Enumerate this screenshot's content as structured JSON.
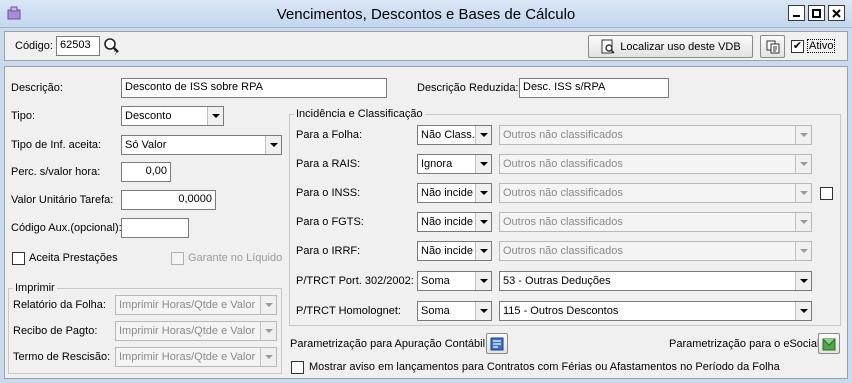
{
  "window": {
    "title": "Vencimentos, Descontos e Bases de Cálculo",
    "app_icon": "app-icon",
    "minimize_icon": "minimize-icon",
    "maximize_icon": "maximize-icon",
    "close_icon": "close-icon"
  },
  "toolbar": {
    "codigo_label": "Código:",
    "codigo_value": "62503",
    "search_icon": "search-icon",
    "localizar_label": "Localizar uso deste VDB",
    "copy_icon": "copy-icon",
    "ativo_label": "Ativo",
    "ativo_checked": true
  },
  "form": {
    "descricao_label": "Descrição:",
    "descricao_value": "Desconto de ISS sobre RPA",
    "descricao_reduzida_label": "Descrição Reduzida:",
    "descricao_reduzida_value": "Desc. ISS s/RPA",
    "tipo_label": "Tipo:",
    "tipo_value": "Desconto",
    "tipo_inf_label": "Tipo de Inf. aceita:",
    "tipo_inf_value": "Só Valor",
    "perc_label": "Perc. s/valor hora:",
    "perc_value": "0,00",
    "valor_unit_label": "Valor Unitário Tarefa:",
    "valor_unit_value": "0,0000",
    "codigo_aux_label": "Código Aux.(opcional):",
    "codigo_aux_value": "",
    "aceita_prestacoes_label": "Aceita Prestações",
    "aceita_prestacoes_checked": false,
    "garante_liquido_label": "Garante no Líquido",
    "garante_liquido_checked": false
  },
  "imprimir": {
    "title": "Imprimir",
    "rows": [
      {
        "label": "Relatório da Folha:",
        "value": "Imprimir Horas/Qtde e Valor"
      },
      {
        "label": "Recibo de Pagto:",
        "value": "Imprimir Horas/Qtde e Valor"
      },
      {
        "label": "Termo de Rescisão:",
        "value": "Imprimir Horas/Qtde e Valor"
      }
    ]
  },
  "incidencia": {
    "title": "Incidência e Classificação",
    "rows": [
      {
        "label": "Para a Folha:",
        "option": "Não Class.",
        "classification": "Outros não classificados"
      },
      {
        "label": "Para a RAIS:",
        "option": "Ignora",
        "classification": "Outros não classificados"
      },
      {
        "label": "Para o INSS:",
        "option": "Não incide",
        "classification": "Outros não classificados"
      },
      {
        "label": "Para o FGTS:",
        "option": "Não incide",
        "classification": "Outros não classificados"
      },
      {
        "label": "Para o IRRF:",
        "option": "Não incide",
        "classification": "Outros não classificados"
      },
      {
        "label": "P/TRCT Port. 302/2002:",
        "option": "Soma",
        "classification": "53 - Outras Deduções"
      },
      {
        "label": "P/TRCT Homolognet:",
        "option": "Soma",
        "classification": "115 - Outros Descontos"
      }
    ],
    "inss_extra_checked": false
  },
  "footer": {
    "param_contabil_label": "Parametrização para Apuração Contábil:",
    "param_contabil_icon": "accounting-icon",
    "param_esocial_label": "Parametrização para o eSocial:",
    "param_esocial_icon": "esocial-icon",
    "aviso_label": "Mostrar aviso em lançamentos para Contratos com Férias ou Afastamentos no Período da Folha",
    "aviso_checked": false
  }
}
